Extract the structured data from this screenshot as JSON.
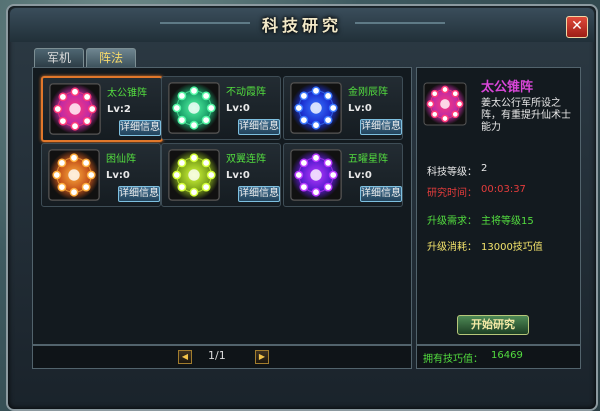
{
  "window": {
    "title": "科技研究",
    "close_icon": "close-icon"
  },
  "tabs": [
    {
      "label": "军机"
    },
    {
      "label": "阵法"
    }
  ],
  "formations": [
    {
      "name": "太公锥阵",
      "level": "Lv:2",
      "detail": "详细信息",
      "color": "#c02aa5",
      "glow": "#ff3a7a"
    },
    {
      "name": "不动霞阵",
      "level": "Lv:0",
      "detail": "详细信息",
      "color": "#1aa26a",
      "glow": "#54f7a5"
    },
    {
      "name": "金刚辰阵",
      "level": "Lv:0",
      "detail": "详细信息",
      "color": "#1b2fd1",
      "glow": "#3a77ff"
    },
    {
      "name": "困仙阵",
      "level": "Lv:0",
      "detail": "详细信息",
      "color": "#c5531a",
      "glow": "#ffaf3e"
    },
    {
      "name": "双翼连阵",
      "level": "Lv:0",
      "detail": "详细信息",
      "color": "#7da31a",
      "glow": "#d5ff3a"
    },
    {
      "name": "五曜星阵",
      "level": "Lv:0",
      "detail": "详细信息",
      "color": "#5a1bd1",
      "glow": "#b93aff"
    }
  ],
  "pager": {
    "text": "1/1",
    "prev_icon": "prev-page-icon",
    "next_icon": "next-page-icon"
  },
  "detail": {
    "name": "太公锥阵",
    "description": "姜太公行军所设之阵，有重提升仙术士能力",
    "rows": [
      {
        "label": "科技等级：",
        "value": "2",
        "label_color": "#e8e8e8",
        "value_color": "#e8e8e8"
      },
      {
        "label": "研究时间：",
        "value": "00:03:37",
        "label_color": "#e53c3c",
        "value_color": "#e53c3c"
      },
      {
        "label": "升级需求：",
        "value": "主将等级15",
        "label_color": "#53dd3f",
        "value_color": "#53dd3f"
      },
      {
        "label": "升级消耗：",
        "value": "13000技巧值",
        "label_color": "#f3e36b",
        "value_color": "#f3e36b"
      }
    ],
    "start_button": "开始研究"
  },
  "footer": {
    "label": "拥有技巧值：",
    "value": "16469"
  }
}
